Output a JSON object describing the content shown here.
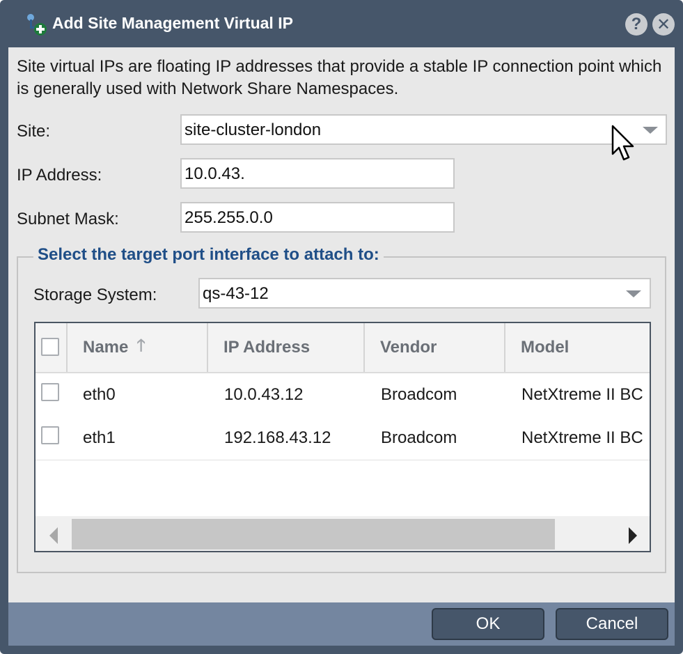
{
  "dialog": {
    "title": "Add Site Management Virtual IP",
    "icon": "add-network-icon",
    "help_label": "?",
    "close_label": "✕"
  },
  "description": "Site virtual IPs are floating IP addresses that provide a stable IP connection point which is generally used with Network Share Namespaces.",
  "form": {
    "site_label": "Site:",
    "site_value": "site-cluster-london",
    "ip_label": "IP Address:",
    "ip_value": "10.0.43.",
    "subnet_label": "Subnet Mask:",
    "subnet_value": "255.255.0.0"
  },
  "target": {
    "legend": "Select the target port interface to attach to:",
    "storage_label": "Storage System:",
    "storage_value": "qs-43-12"
  },
  "grid": {
    "columns": [
      "Name",
      "IP Address",
      "Vendor",
      "Model"
    ],
    "sort_column": "Name",
    "sort_direction": "ascending",
    "rows": [
      {
        "name": "eth0",
        "ip": "10.0.43.12",
        "vendor": "Broadcom",
        "model": "NetXtreme II BC"
      },
      {
        "name": "eth1",
        "ip": "192.168.43.12",
        "vendor": "Broadcom",
        "model": "NetXtreme II BC"
      }
    ]
  },
  "buttons": {
    "ok": "OK",
    "cancel": "Cancel"
  },
  "colors": {
    "titlebar": "#46566a",
    "footer": "#7486a0",
    "legend": "#1f4e87",
    "body": "#e8e8e8"
  }
}
